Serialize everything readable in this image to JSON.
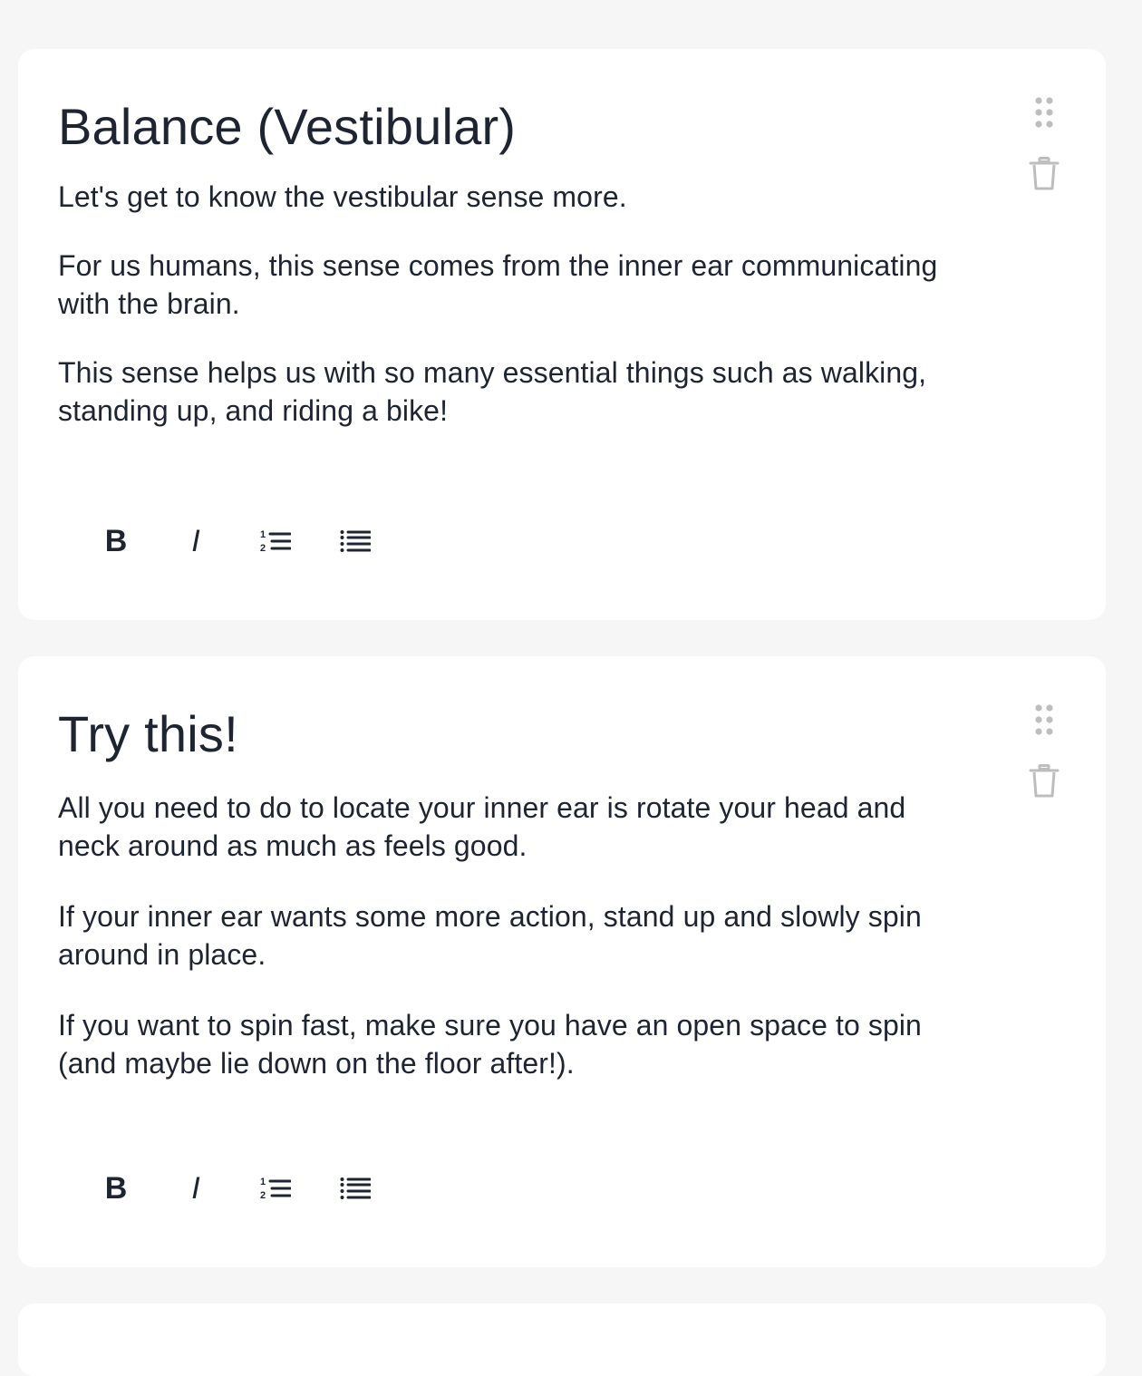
{
  "colors": {
    "page_background": "#f6f6f6",
    "card_background": "#ffffff",
    "text": "#1f2433",
    "icon_muted": "#bdbdbd"
  },
  "cards": [
    {
      "title": "Balance (Vestibular)",
      "paragraphs": [
        "Let's get to know the vestibular sense more.",
        "For us humans, this sense comes from the inner ear communicating with the brain.",
        "This sense helps us with so many essential things such as walking, standing up, and riding a bike!"
      ],
      "toolbar": {
        "bold_label": "B",
        "italic_label": "I"
      },
      "action_icons": [
        "drag-handle-icon",
        "trash-icon"
      ]
    },
    {
      "title": "Try this!",
      "paragraphs": [
        "All you need to do to locate your inner ear is rotate your head and neck around as much as feels good.",
        "If your inner ear wants some more action, stand up and slowly spin around in place.",
        "If you want to spin fast, make sure you have an open space to spin (and maybe lie down on the floor after!)."
      ],
      "toolbar": {
        "bold_label": "B",
        "italic_label": "I"
      },
      "action_icons": [
        "drag-handle-icon",
        "trash-icon"
      ]
    }
  ],
  "toolbar_icons": [
    "bold-icon",
    "italic-icon",
    "ordered-list-icon",
    "bullet-list-icon"
  ]
}
